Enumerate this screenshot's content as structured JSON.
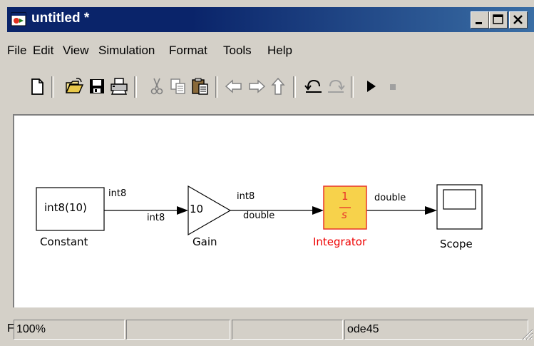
{
  "window": {
    "title": "untitled *"
  },
  "title_buttons": {
    "minimize": "minimize-icon",
    "maximize": "maximize-icon",
    "close": "close-icon"
  },
  "menu": {
    "items": [
      "File",
      "Edit",
      "View",
      "Simulation",
      "Format",
      "Tools",
      "Help"
    ]
  },
  "toolbar": {
    "icons": [
      "new-file-icon",
      "open-folder-icon",
      "save-icon",
      "print-icon",
      "cut-icon",
      "copy-icon",
      "paste-icon",
      "back-arrow-icon",
      "forward-arrow-icon",
      "up-arrow-icon",
      "undo-icon",
      "redo-icon",
      "play-icon",
      "stop-icon"
    ]
  },
  "diagram": {
    "blocks": {
      "constant": {
        "content": "int8(10)",
        "name": "Constant"
      },
      "gain": {
        "content": "10",
        "name": "Gain"
      },
      "integrator": {
        "numerator": "1",
        "denominator": "s",
        "name": "Integrator"
      },
      "scope": {
        "name": "Scope"
      }
    },
    "signals": {
      "constant_out": "int8",
      "gain_in": "int8",
      "gain_out": "int8",
      "integrator_in": "double",
      "integrator_out": "double"
    },
    "colors": {
      "integrator_fill": "#f7d24b",
      "integrator_border": "#e8342a",
      "integrator_label": "#ee0000"
    }
  },
  "status": {
    "left_fragment": "F",
    "zoom": "100%",
    "solver": "ode45"
  }
}
